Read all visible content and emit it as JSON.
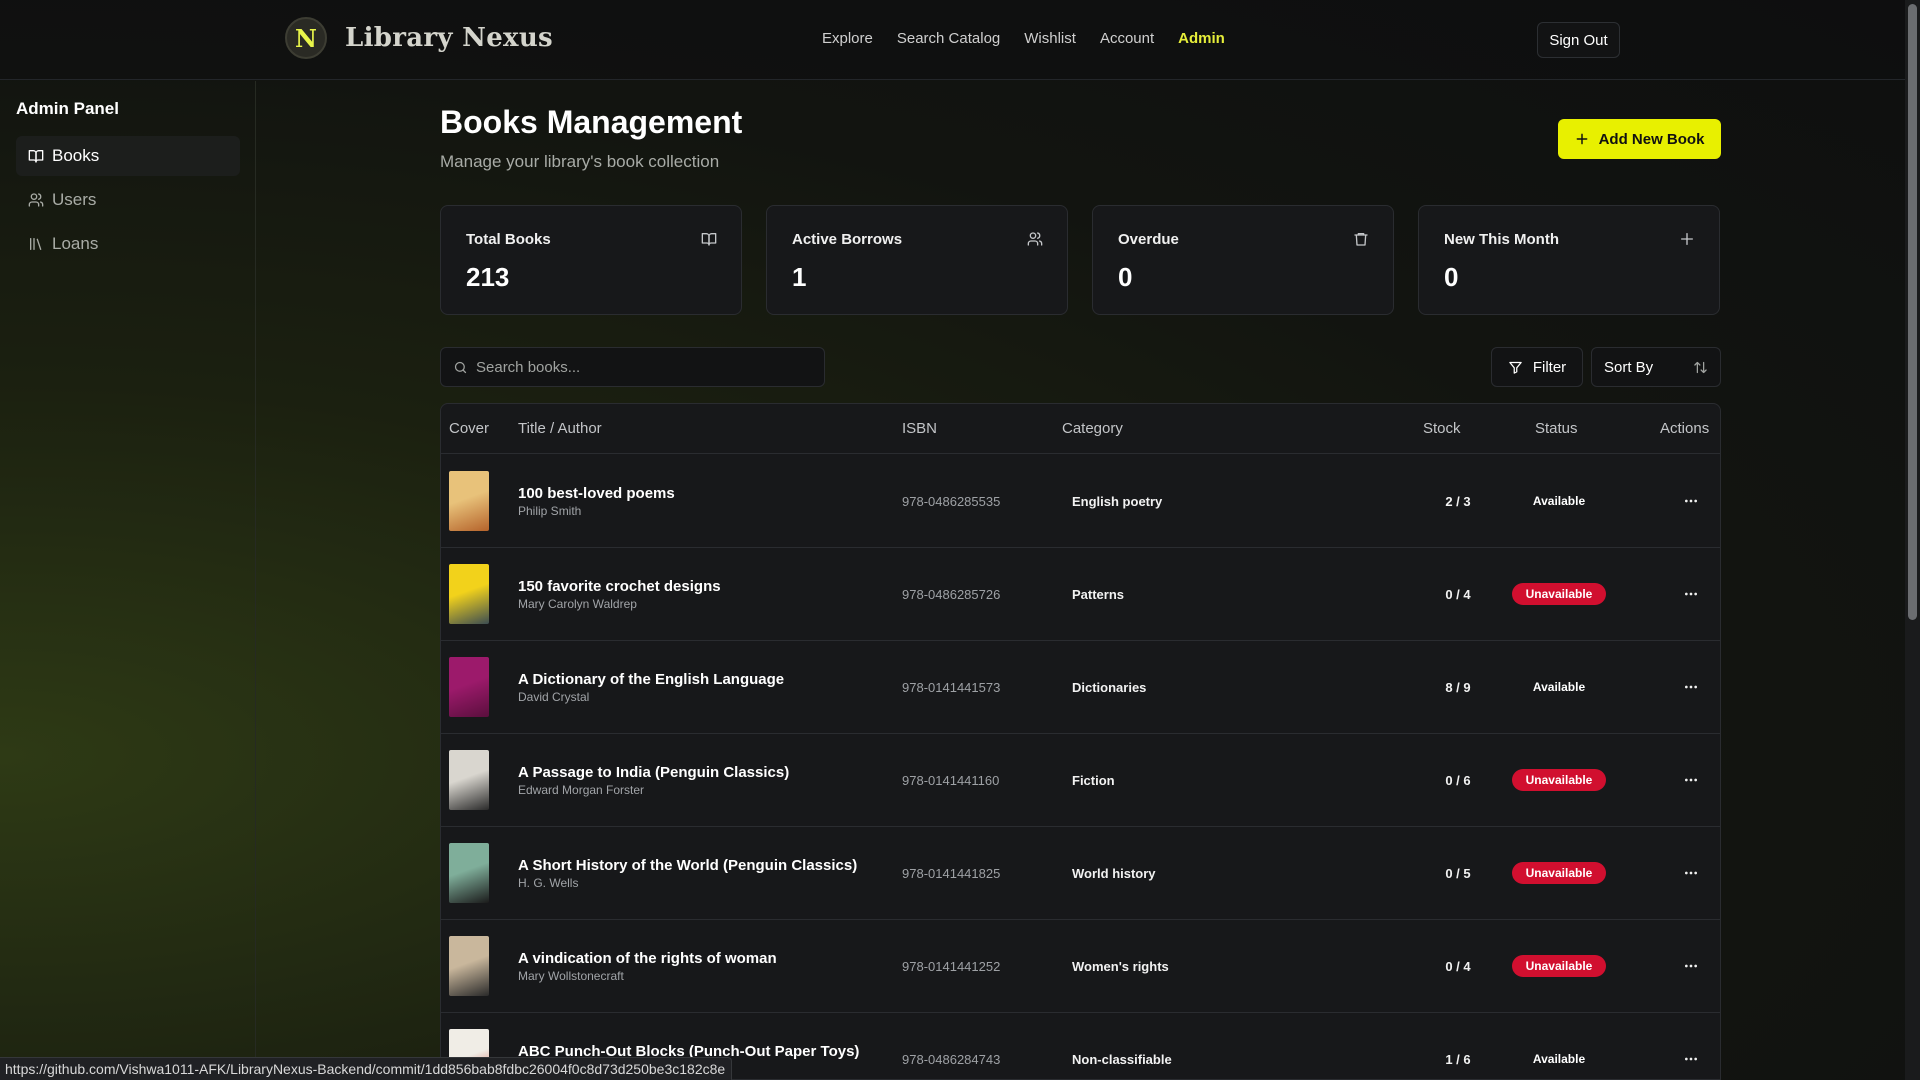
{
  "app": {
    "logo_letter": "N",
    "name": "Library Nexus"
  },
  "nav": {
    "items": [
      {
        "label": "Explore",
        "active": false
      },
      {
        "label": "Search Catalog",
        "active": false
      },
      {
        "label": "Wishlist",
        "active": false
      },
      {
        "label": "Account",
        "active": false
      },
      {
        "label": "Admin",
        "active": true
      }
    ],
    "sign_out": "Sign Out"
  },
  "sidebar": {
    "title": "Admin Panel",
    "items": [
      {
        "label": "Books",
        "icon": "book-open-icon",
        "active": true
      },
      {
        "label": "Users",
        "icon": "users-icon",
        "active": false
      },
      {
        "label": "Loans",
        "icon": "library-icon",
        "active": false
      }
    ]
  },
  "main": {
    "title": "Books Management",
    "subtitle": "Manage your library's book collection",
    "add_button": "Add New Book"
  },
  "stats": [
    {
      "label": "Total Books",
      "value": "213",
      "icon": "book-open-icon"
    },
    {
      "label": "Active Borrows",
      "value": "1",
      "icon": "users-icon"
    },
    {
      "label": "Overdue",
      "value": "0",
      "icon": "trash-icon"
    },
    {
      "label": "New This Month",
      "value": "0",
      "icon": "plus-icon"
    }
  ],
  "toolbar": {
    "search_placeholder": "Search books...",
    "filter_label": "Filter",
    "sort_label": "Sort By"
  },
  "table": {
    "headers": [
      "Cover",
      "Title / Author",
      "ISBN",
      "Category",
      "Stock",
      "Status",
      "Actions"
    ],
    "rows": [
      {
        "title": "100 best-loved poems",
        "author": "Philip Smith",
        "isbn": "978-0486285535",
        "category": "English poetry",
        "stock": "2 / 3",
        "status": "Available",
        "cover_colors": [
          "#e8c27a",
          "#b5632b"
        ]
      },
      {
        "title": "150 favorite crochet designs",
        "author": "Mary Carolyn Waldrep",
        "isbn": "978-0486285726",
        "category": "Patterns",
        "stock": "0 / 4",
        "status": "Unavailable",
        "cover_colors": [
          "#f2d21b",
          "#3c4d52"
        ]
      },
      {
        "title": "A Dictionary of the English Language",
        "author": "David Crystal",
        "isbn": "978-0141441573",
        "category": "Dictionaries",
        "stock": "8 / 9",
        "status": "Available",
        "cover_colors": [
          "#9c1a6b",
          "#5a0f3d"
        ]
      },
      {
        "title": "A Passage to India (Penguin Classics)",
        "author": "Edward Morgan Forster",
        "isbn": "978-0141441160",
        "category": "Fiction",
        "stock": "0 / 6",
        "status": "Unavailable",
        "cover_colors": [
          "#d9d6cf",
          "#2a2a2a"
        ]
      },
      {
        "title": "A Short History of the World (Penguin Classics)",
        "author": "H. G. Wells",
        "isbn": "978-0141441825",
        "category": "World history",
        "stock": "0 / 5",
        "status": "Unavailable",
        "cover_colors": [
          "#7fae9a",
          "#1b1b1b"
        ]
      },
      {
        "title": "A vindication of the rights of woman",
        "author": "Mary Wollstonecraft",
        "isbn": "978-0141441252",
        "category": "Women's rights",
        "stock": "0 / 4",
        "status": "Unavailable",
        "cover_colors": [
          "#c9b79c",
          "#2a2a2a"
        ]
      },
      {
        "title": "ABC Punch-Out Blocks (Punch-Out Paper Toys)",
        "author": "",
        "isbn": "978-0486284743",
        "category": "Non-classifiable",
        "stock": "1 / 6",
        "status": "Available",
        "cover_colors": [
          "#f0ede6",
          "#c43a2a"
        ]
      }
    ]
  },
  "statusbar": {
    "url": "https://github.com/Vishwa1011-AFK/LibraryNexus-Backend/commit/1dd856bab8fdbc26004f0c8d73d250be3c182c8e"
  },
  "colors": {
    "accent": "#e8f000",
    "danger": "#d10f2f",
    "admin_link": "#e6ee3a"
  }
}
